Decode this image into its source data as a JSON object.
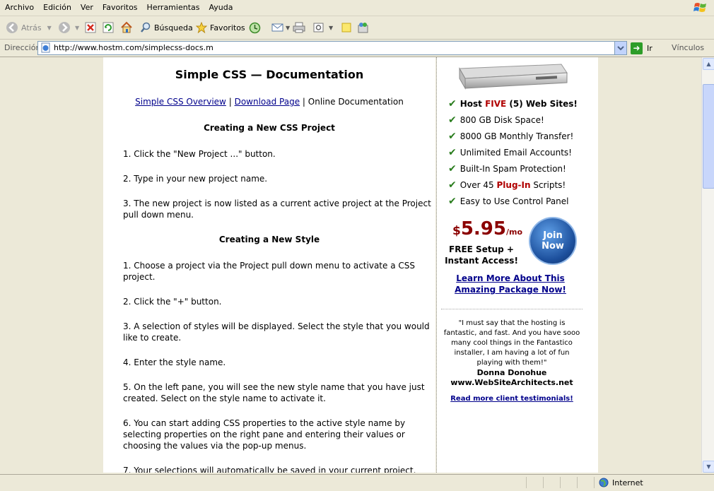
{
  "menu": [
    "Archivo",
    "Edición",
    "Ver",
    "Favoritos",
    "Herramientas",
    "Ayuda"
  ],
  "toolbar": {
    "back": "Atrás",
    "search": "Búsqueda",
    "favorites": "Favoritos"
  },
  "address": {
    "label": "Dirección",
    "url": "http://www.hostm.com/simplecss-docs.m",
    "go": "Ir",
    "links": "Vínculos"
  },
  "doc": {
    "title": "Simple CSS — Documentation",
    "nav": {
      "overview": "Simple CSS Overview",
      "sep1": "|",
      "download": "Download Page",
      "sep2": "|",
      "online": "Online Documentation"
    },
    "sections": [
      {
        "heading": "Creating a New CSS Project",
        "steps": [
          "1. Click the \"New Project ...\" button.",
          "2. Type in your new project name.",
          "3. The new project is now listed as a current active project at the Project pull down menu."
        ]
      },
      {
        "heading": "Creating a New Style",
        "steps": [
          "1. Choose a project via the Project pull down menu to activate a CSS project.",
          "2. Click the \"+\" button.",
          "3. A selection of styles will be displayed. Select the style that you would like to create.",
          "4. Enter the style name.",
          "5. On the left pane, you will see the new style name that you have just created. Select on the style name to activate it.",
          "6. You can start adding CSS properties to the active style name by selecting properties on the right pane and entering their values or choosing the values via the pop-up menus.",
          "7. Your selections will automatically be saved in your current project."
        ]
      }
    ]
  },
  "ad": {
    "features": [
      {
        "pre": "Host ",
        "hl": "FIVE",
        "post": " (5) Web Sites!"
      },
      {
        "pre": "800 GB Disk Space!",
        "hl": "",
        "post": ""
      },
      {
        "pre": "8000 GB Monthly Transfer!",
        "hl": "",
        "post": ""
      },
      {
        "pre": "Unlimited Email Accounts!",
        "hl": "",
        "post": ""
      },
      {
        "pre": "Built-In Spam Protection!",
        "hl": "",
        "post": ""
      },
      {
        "pre": "Over 45 ",
        "hl": "Plug-In",
        "post": " Scripts!"
      },
      {
        "pre": "Easy to Use Control Panel",
        "hl": "",
        "post": ""
      }
    ],
    "price_dollar": "$",
    "price": "5.95",
    "price_unit": "/mo",
    "setup_line1": "FREE Setup +",
    "setup_line2": "Instant Access!",
    "join_line1": "Join",
    "join_line2": "Now",
    "learn_line1": "Learn More About This",
    "learn_line2": "Amazing Package Now!",
    "quote": "\"I must say that the hosting is fantastic, and fast. And you have sooo many cool things in the Fantastico installer, I am having a lot of fun playing with them!\"",
    "author": "Donna Donohue",
    "site": "www.WebSiteArchitects.net",
    "testimonials": "Read more client testimonials!"
  },
  "status": {
    "zone": "Internet"
  },
  "colors": {
    "chrome": "#ece9d8",
    "link": "#00008b",
    "highlight": "#b00000",
    "check": "#2a7d1e"
  }
}
